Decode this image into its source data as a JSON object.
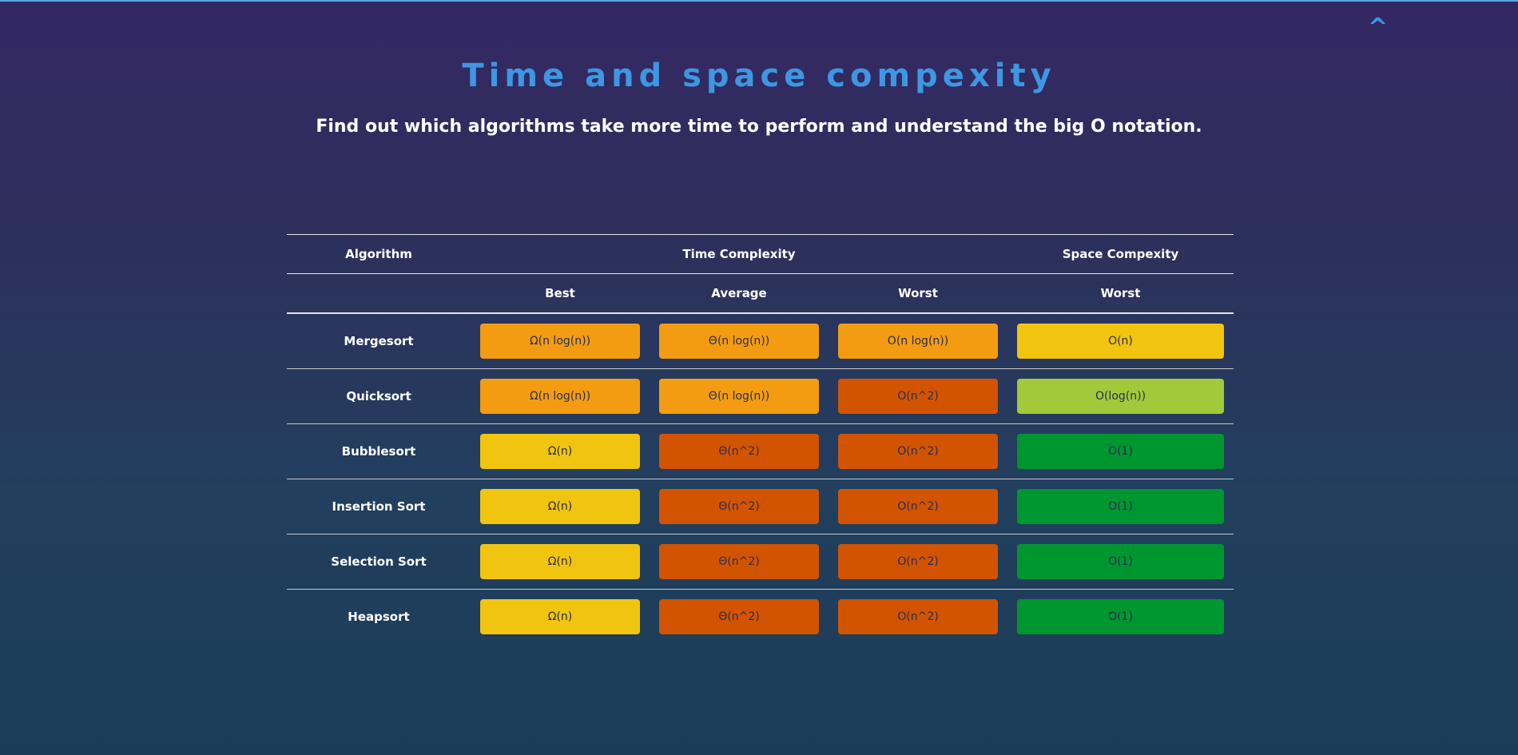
{
  "scroll_top": {
    "label": "^"
  },
  "header": {
    "title": "Time and space compexity",
    "subtitle": "Find out which algorithms take more time to perform and understand the big O notation."
  },
  "table": {
    "group_headers": {
      "algorithm": "Algorithm",
      "time": "Time Complexity",
      "space": "Space Compexity"
    },
    "sub_headers": {
      "best": "Best",
      "average": "Average",
      "worst": "Worst",
      "space_worst": "Worst"
    },
    "colors": {
      "orange": "#f39c12",
      "dark_orange": "#d35400",
      "yellow": "#f1c40f",
      "light_green": "#a1c93a",
      "green": "#00962f"
    },
    "rows": [
      {
        "name": "Mergesort",
        "best": "Ω(n log(n))",
        "best_color": "#f39c12",
        "average": "Θ(n log(n))",
        "average_color": "#f39c12",
        "worst": "O(n log(n))",
        "worst_color": "#f39c12",
        "space": "O(n)",
        "space_color": "#f1c40f"
      },
      {
        "name": "Quicksort",
        "best": "Ω(n log(n))",
        "best_color": "#f39c12",
        "average": "Θ(n log(n))",
        "average_color": "#f39c12",
        "worst": "O(n^2)",
        "worst_color": "#d35400",
        "space": "O(log(n))",
        "space_color": "#a1c93a"
      },
      {
        "name": "Bubblesort",
        "best": "Ω(n)",
        "best_color": "#f1c40f",
        "average": "Θ(n^2)",
        "average_color": "#d35400",
        "worst": "O(n^2)",
        "worst_color": "#d35400",
        "space": "O(1)",
        "space_color": "#00962f"
      },
      {
        "name": "Insertion Sort",
        "best": "Ω(n)",
        "best_color": "#f1c40f",
        "average": "Θ(n^2)",
        "average_color": "#d35400",
        "worst": "O(n^2)",
        "worst_color": "#d35400",
        "space": "O(1)",
        "space_color": "#00962f"
      },
      {
        "name": "Selection Sort",
        "best": "Ω(n)",
        "best_color": "#f1c40f",
        "average": "Θ(n^2)",
        "average_color": "#d35400",
        "worst": "O(n^2)",
        "worst_color": "#d35400",
        "space": "O(1)",
        "space_color": "#00962f"
      },
      {
        "name": "Heapsort",
        "best": "Ω(n)",
        "best_color": "#f1c40f",
        "average": "Θ(n^2)",
        "average_color": "#d35400",
        "worst": "O(n^2)",
        "worst_color": "#d35400",
        "space": "O(1)",
        "space_color": "#00962f"
      }
    ]
  }
}
